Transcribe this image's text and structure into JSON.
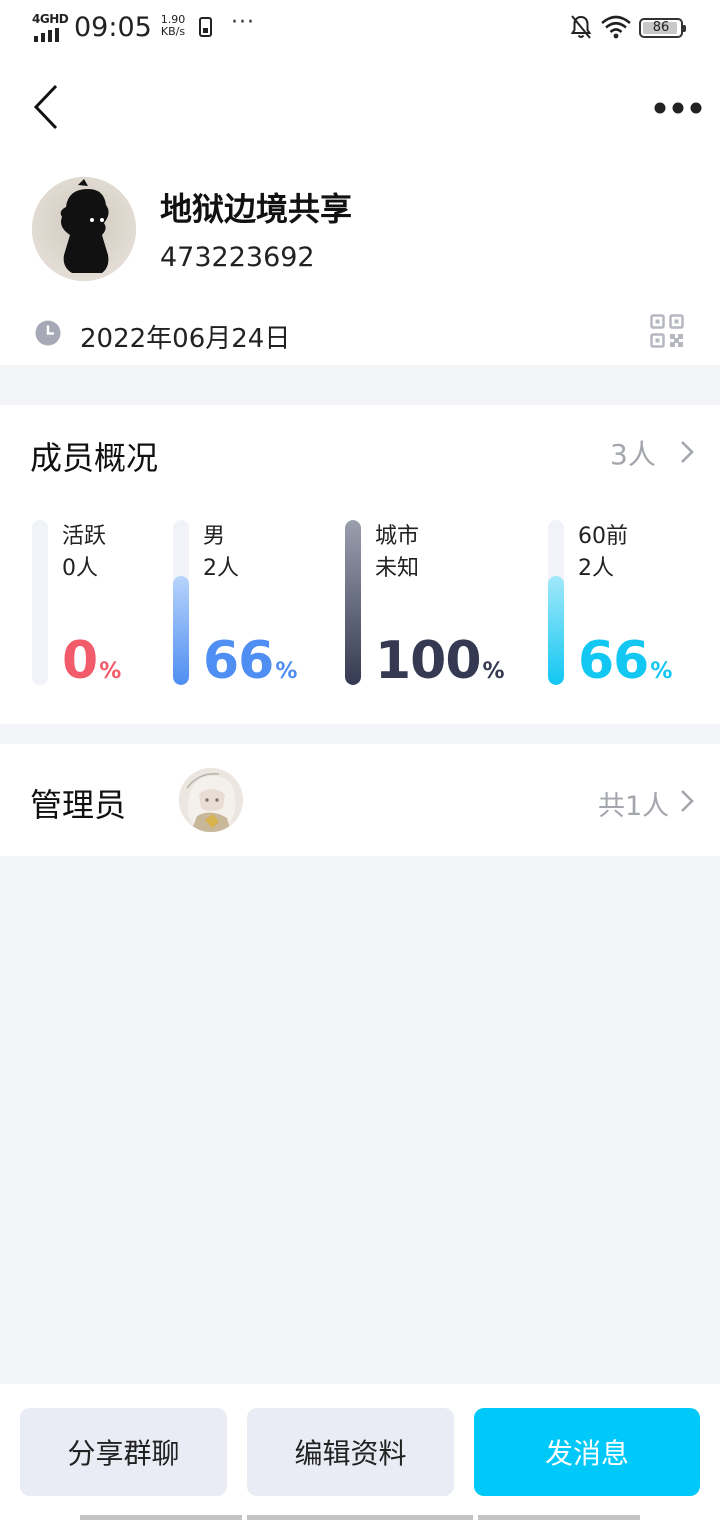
{
  "status_bar": {
    "network": "4GHD",
    "time": "09:05",
    "speed_value": "1.90",
    "speed_unit": "KB/s",
    "overflow": "···",
    "battery": "86",
    "icons": [
      "signal-icon",
      "phone-icon",
      "bell-off-icon",
      "wifi-icon",
      "battery-icon"
    ]
  },
  "header": {
    "back_icon": "chevron-left-icon",
    "more_icon": "more-dots-icon",
    "group_name": "地狱边境共享",
    "group_id": "473223692",
    "created_date": "2022年06月24日",
    "clock_icon": "clock-icon",
    "qr_icon": "qr-code-icon"
  },
  "members": {
    "title": "成员概况",
    "count": "3人",
    "stats": [
      {
        "label1": "活跃",
        "label2": "0人",
        "percent": "0",
        "unit": "%",
        "fill_fraction": 0.0,
        "color": "#f25b6a"
      },
      {
        "label1": "男",
        "label2": "2人",
        "percent": "66",
        "unit": "%",
        "fill_fraction": 0.66,
        "color": "#4f8ef2"
      },
      {
        "label1": "城市",
        "label2": "未知",
        "percent": "100",
        "unit": "%",
        "fill_fraction": 1.0,
        "color": "#353a52"
      },
      {
        "label1": "60前",
        "label2": "2人",
        "percent": "66",
        "unit": "%",
        "fill_fraction": 0.66,
        "color": "#12c7f2"
      }
    ]
  },
  "admins": {
    "title": "管理员",
    "count": "共1人"
  },
  "actions": {
    "share_label": "分享群聊",
    "edit_label": "编辑资料",
    "send_label": "发消息"
  },
  "colors": {
    "accent": "#00c8f8",
    "page_bg": "#f3f5f9",
    "secondary_text": "#a3a6ad"
  }
}
